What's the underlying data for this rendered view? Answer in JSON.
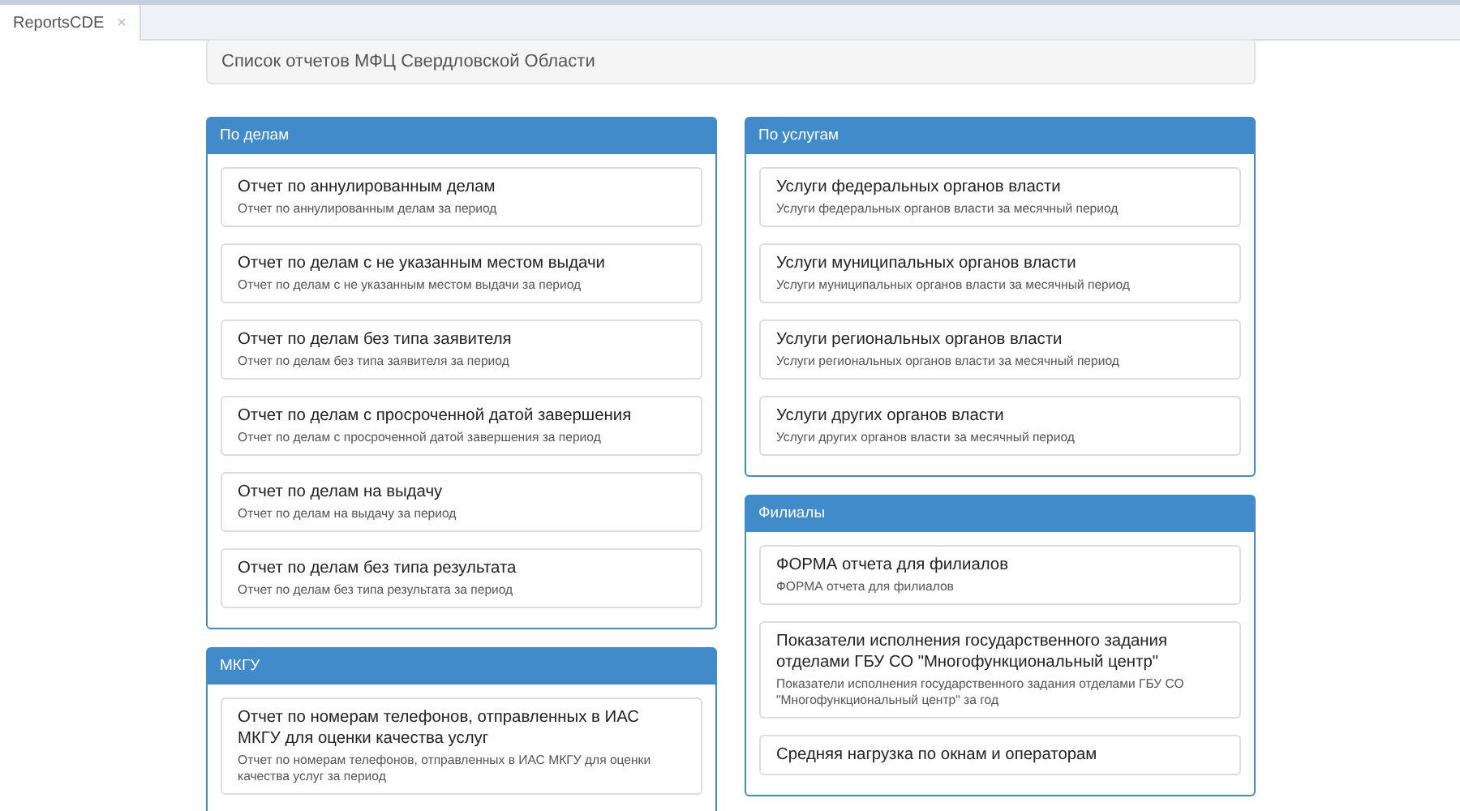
{
  "tabs": [
    {
      "label": "ReportsCDE",
      "selected": true,
      "close": "×"
    }
  ],
  "page_title": "Список отчетов МФЦ Свердловской Области",
  "columns": [
    {
      "panels": [
        {
          "title": "По делам",
          "items": [
            {
              "title": "Отчет по аннулированным делам",
              "description": "Отчет по аннулированным делам за период"
            },
            {
              "title": "Отчет по делам с не указанным местом выдачи",
              "description": "Отчет по делам с не указанным местом выдачи за период"
            },
            {
              "title": "Отчет по делам без типа заявителя",
              "description": "Отчет по делам без типа заявителя за период"
            },
            {
              "title": "Отчет по делам с просроченной датой завершения",
              "description": "Отчет по делам с просроченной датой завершения за период"
            },
            {
              "title": "Отчет по делам на выдачу",
              "description": "Отчет по делам на выдачу за период"
            },
            {
              "title": "Отчет по делам без типа результата",
              "description": "Отчет по делам без типа результата за период"
            }
          ]
        },
        {
          "title": "МКГУ",
          "items": [
            {
              "title": "Отчет по номерам телефонов, отправленных в ИАС МКГУ для оценки качества услуг",
              "description": "Отчет по номерам телефонов, отправленных в ИАС МКГУ для оценки качества услуг за период"
            }
          ]
        }
      ]
    },
    {
      "panels": [
        {
          "title": "По услугам",
          "items": [
            {
              "title": "Услуги федеральных органов власти",
              "description": "Услуги федеральных органов власти за месячный период"
            },
            {
              "title": "Услуги муниципальных органов власти",
              "description": "Услуги муниципальных органов власти за месячный период"
            },
            {
              "title": "Услуги региональных органов власти",
              "description": "Услуги региональных органов власти за месячный период"
            },
            {
              "title": "Услуги других органов власти",
              "description": "Услуги других органов власти за месячный период"
            }
          ]
        },
        {
          "title": "Филиалы",
          "items": [
            {
              "title": "ФОРМА отчета для филиалов",
              "description": "ФОРМА отчета для филиалов"
            },
            {
              "title": "Показатели исполнения государственного задания отделами ГБУ СО \"Многофункциональный центр\"",
              "description": "Показатели исполнения государственного задания отделами ГБУ СО \"Многофункциональный центр\" за год"
            },
            {
              "title": "Средняя нагрузка по окнам и операторам"
            }
          ]
        }
      ]
    }
  ]
}
